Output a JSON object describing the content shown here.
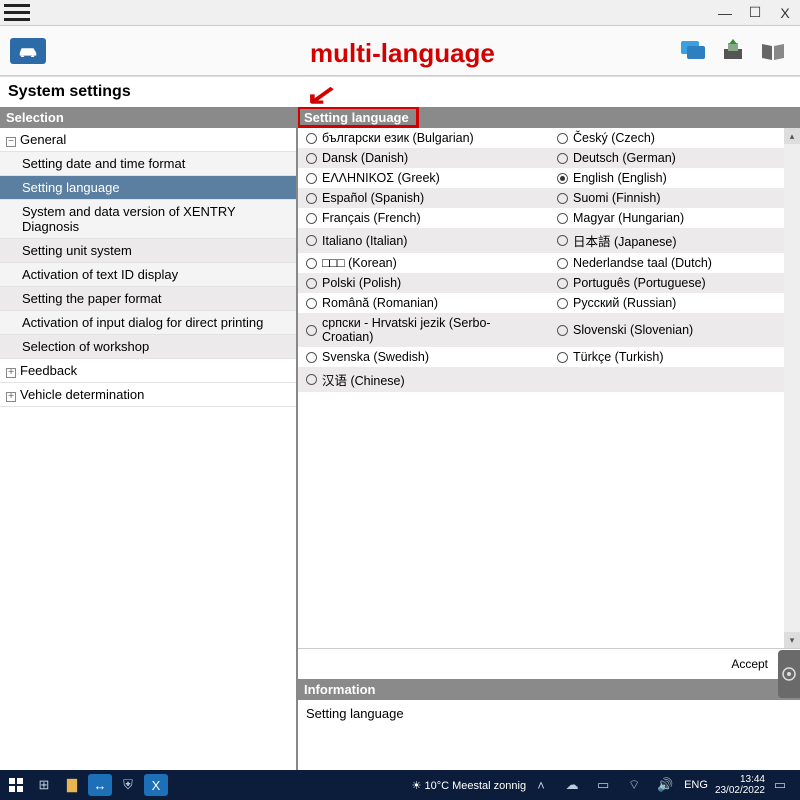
{
  "annotation": {
    "label": "multi-language"
  },
  "page": {
    "title": "System settings"
  },
  "sidebar": {
    "header": "Selection",
    "nodes": [
      {
        "label": "General",
        "level": 0,
        "expanded": true
      },
      {
        "label": "Setting date and time format",
        "level": 1
      },
      {
        "label": "Setting language",
        "level": 1,
        "selected": true
      },
      {
        "label": "System and data version of XENTRY Diagnosis",
        "level": 1
      },
      {
        "label": "Setting unit system",
        "level": 1
      },
      {
        "label": "Activation of text ID display",
        "level": 1
      },
      {
        "label": "Setting the paper format",
        "level": 1
      },
      {
        "label": "Activation of input dialog for direct printing",
        "level": 1
      },
      {
        "label": "Selection of workshop",
        "level": 1
      },
      {
        "label": "Feedback",
        "level": 0
      },
      {
        "label": "Vehicle determination",
        "level": 0
      }
    ]
  },
  "panel": {
    "header": "Setting language",
    "languages": [
      {
        "left": "български език (Bulgarian)",
        "right": "Český (Czech)"
      },
      {
        "left": "Dansk (Danish)",
        "right": "Deutsch (German)"
      },
      {
        "left": "ΕΛΛΗΝΙΚΟΣ (Greek)",
        "right": "English (English)",
        "right_checked": true
      },
      {
        "left": "Español (Spanish)",
        "right": "Suomi (Finnish)"
      },
      {
        "left": "Français (French)",
        "right": "Magyar (Hungarian)"
      },
      {
        "left": "Italiano (Italian)",
        "right": "日本語 (Japanese)"
      },
      {
        "left": "□□□ (Korean)",
        "right": "Nederlandse taal (Dutch)"
      },
      {
        "left": "Polski (Polish)",
        "right": "Português (Portuguese)"
      },
      {
        "left": "Română (Romanian)",
        "right": "Русский (Russian)"
      },
      {
        "left": "српски - Hrvatski jezik (Serbo-Croatian)",
        "right": "Slovenski (Slovenian)"
      },
      {
        "left": "Svenska (Swedish)",
        "right": "Türkçe (Turkish)"
      },
      {
        "left": "汉语 (Chinese)",
        "right": ""
      }
    ],
    "accept": "Accept"
  },
  "info": {
    "header": "Information",
    "body": "Setting language"
  },
  "tray": {
    "weather": "10°C  Meestal zonnig",
    "lang": "ENG",
    "time": "13:44",
    "date": "23/02/2022"
  }
}
